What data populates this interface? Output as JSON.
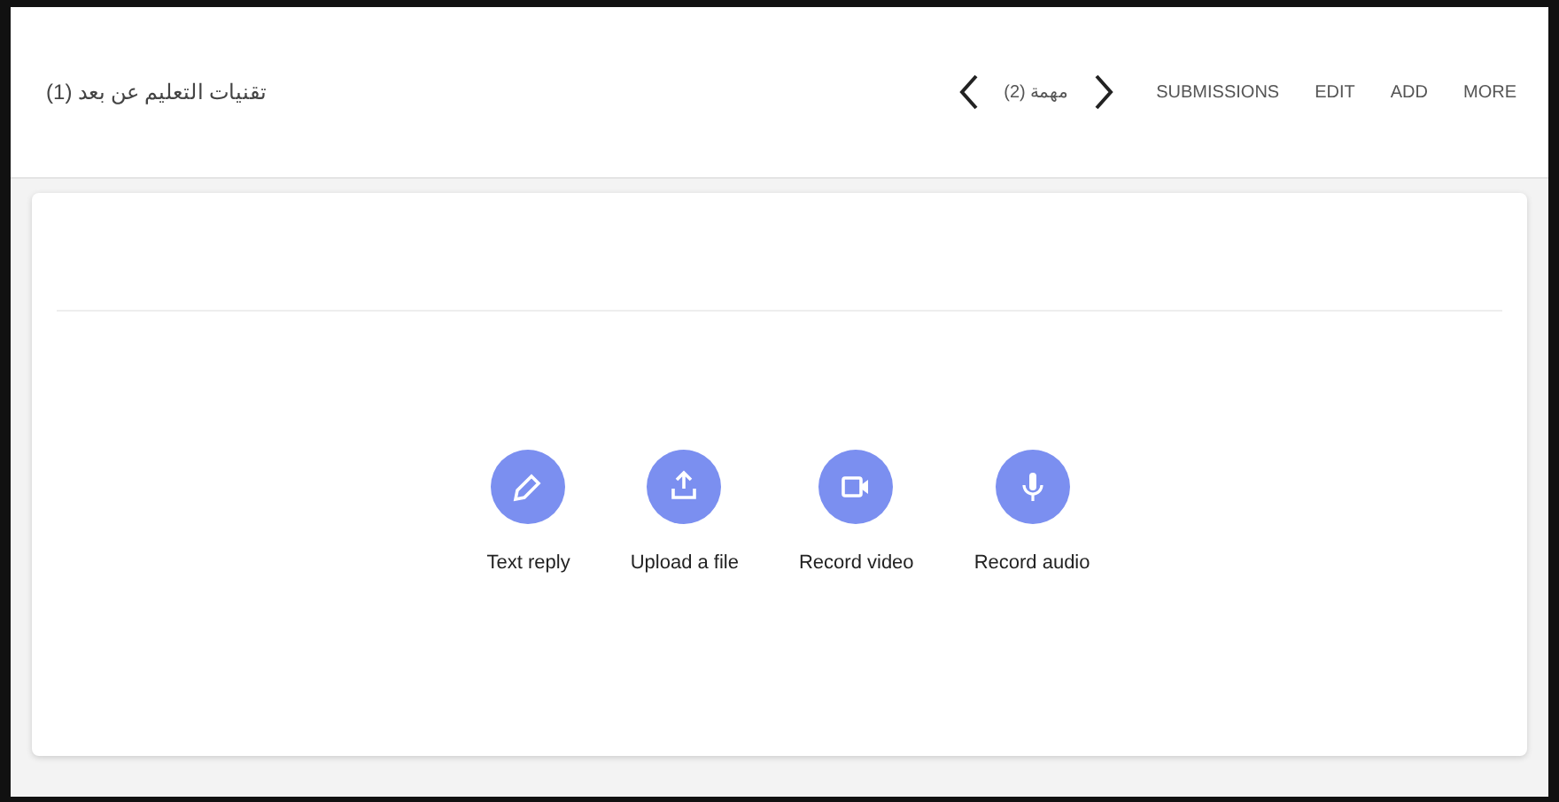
{
  "header": {
    "title": "تقنيات التعليم عن بعد (1)",
    "nav_label": "مهمة (2)",
    "menu": [
      "SUBMISSIONS",
      "EDIT",
      "ADD",
      "MORE"
    ]
  },
  "actions": [
    {
      "kind": "text",
      "label": "Text reply"
    },
    {
      "kind": "upload",
      "label": "Upload a file"
    },
    {
      "kind": "video",
      "label": "Record video"
    },
    {
      "kind": "audio",
      "label": "Record audio"
    }
  ]
}
